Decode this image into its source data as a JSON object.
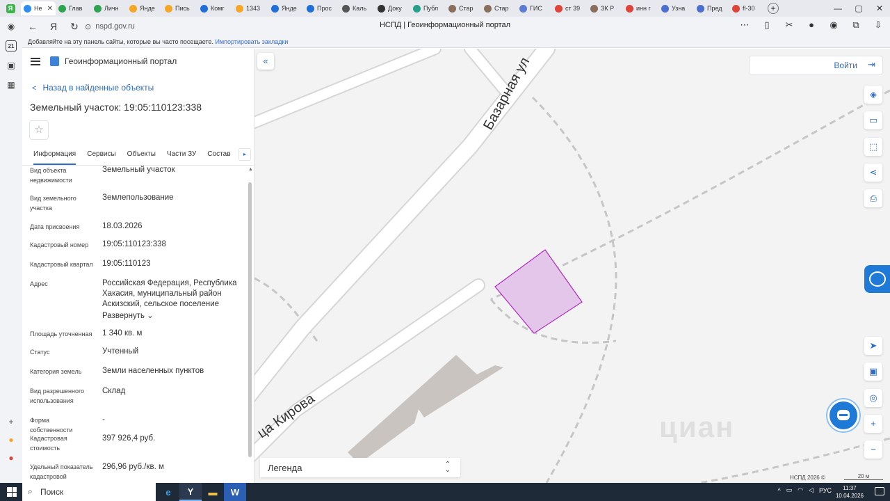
{
  "browser": {
    "tabs": [
      {
        "label": "Не",
        "color": "#2d8cf0",
        "active": true
      },
      {
        "label": "Глав",
        "color": "#2ea44f"
      },
      {
        "label": "Личн",
        "color": "#2ea44f"
      },
      {
        "label": "Янде",
        "color": "#f5a623"
      },
      {
        "label": "Пись",
        "color": "#f5a623"
      },
      {
        "label": "Комг",
        "color": "#1e6fd9"
      },
      {
        "label": "1343",
        "color": "#f5a623"
      },
      {
        "label": "Янде",
        "color": "#1e6fd9"
      },
      {
        "label": "Прос",
        "color": "#1e6fd9"
      },
      {
        "label": "Каль",
        "color": "#555555"
      },
      {
        "label": "Доку",
        "color": "#333333"
      },
      {
        "label": "Публ",
        "color": "#27a08a"
      },
      {
        "label": "Стар",
        "color": "#8a6d5a"
      },
      {
        "label": "Стар",
        "color": "#8a6d5a"
      },
      {
        "label": "ГИС",
        "color": "#5b7bd5"
      },
      {
        "label": "ст 39",
        "color": "#e0433a"
      },
      {
        "label": "ЗК Р",
        "color": "#8a6d5a"
      },
      {
        "label": "инн г",
        "color": "#e0433a"
      },
      {
        "label": "Узна",
        "color": "#4a6fd0"
      },
      {
        "label": "Пред",
        "color": "#4a6fd0"
      },
      {
        "label": "fl-30",
        "color": "#e0433a"
      }
    ],
    "url_host": "nspd.gov.ru",
    "page_title": "НСПД | Геоинформационный портал",
    "bookmarks_hint": "Добавляйте на эту панель сайты, которые вы часто посещаете.",
    "bookmarks_import": "Импортировать закладки",
    "side_badge": "21"
  },
  "app": {
    "portal_name": "Геоинформационный портал",
    "back_link": "Назад в найденные объекты",
    "object_title": "Земельный участок: 19:05:110123:338",
    "tabs": [
      "Информация",
      "Сервисы",
      "Объекты",
      "Части ЗУ",
      "Состав"
    ],
    "properties": [
      {
        "key": "Вид объекта недвижимости",
        "value": "Земельный участок"
      },
      {
        "key": "Вид земельного участка",
        "value": "Землепользование"
      },
      {
        "key": "Дата присвоения",
        "value": "18.03.2026"
      },
      {
        "key": "Кадастровый номер",
        "value": "19:05:110123:338"
      },
      {
        "key": "Кадастровый квартал",
        "value": "19:05:110123"
      },
      {
        "key": "Адрес",
        "value": "Российская Федерация, Республика Хакасия, муниципальный район Аскизский, сельское поселение"
      },
      {
        "key": "Площадь уточненная",
        "value": "1 340 кв. м"
      },
      {
        "key": "Статус",
        "value": "Учтенный"
      },
      {
        "key": "Категория земель",
        "value": "Земли населенных пунктов"
      },
      {
        "key": "Вид разрешенного использования",
        "value": "Склад"
      },
      {
        "key": "Форма собственности",
        "value": "-"
      },
      {
        "key": "Кадастровая стоимость",
        "value": "397 926,4 руб."
      },
      {
        "key": "Удельный показатель кадастровой",
        "value": "296,96 руб./кв. м"
      }
    ],
    "expand_label": "Развернуть"
  },
  "map": {
    "login_label": "Войти",
    "street_1": "Базарная ул",
    "street_2": "ца Кирова",
    "legend_label": "Легенда",
    "copyright": "НСПД 2026 ©",
    "scale": "20 м",
    "watermark": "циан",
    "parcel_color": "#e4c6ea",
    "parcel_stroke": "#b02bbf"
  },
  "taskbar": {
    "search": "Поиск",
    "lang": "РУС",
    "time": "11:37",
    "date": "10.04.2026"
  }
}
